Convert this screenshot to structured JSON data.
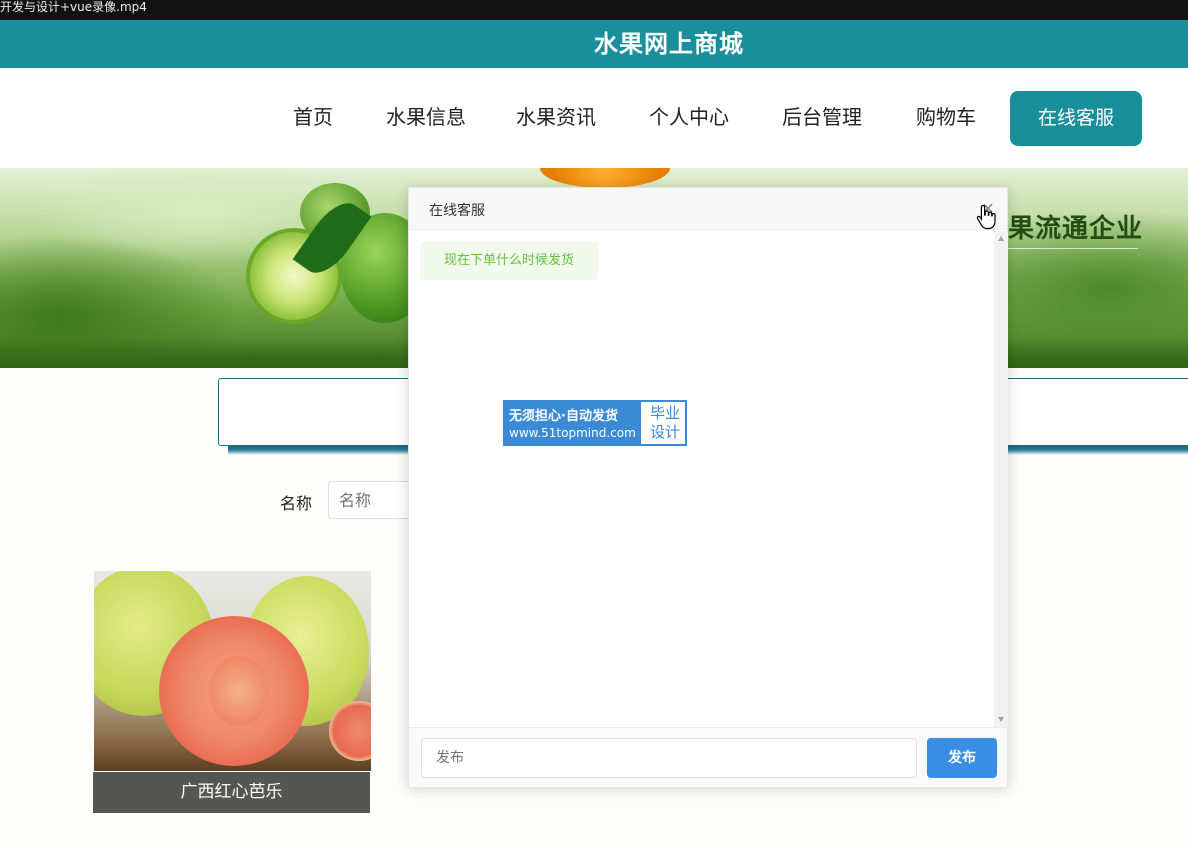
{
  "video_filename": "开发与设计+vue录像.mp4",
  "site": {
    "title": "水果网上商城"
  },
  "nav": {
    "items": [
      {
        "label": "首页"
      },
      {
        "label": "水果信息"
      },
      {
        "label": "水果资讯"
      },
      {
        "label": "个人中心"
      },
      {
        "label": "后台管理"
      },
      {
        "label": "购物车"
      }
    ],
    "customer_service_label": "在线客服"
  },
  "banner": {
    "text": "果流通企业"
  },
  "search": {
    "name_label": "名称",
    "name_placeholder": "名称"
  },
  "products": [
    {
      "name": "广西红心芭乐"
    }
  ],
  "chat": {
    "title": "在线客服",
    "close_icon": "close-icon",
    "messages": [
      {
        "text": "现在下单什么时候发货"
      }
    ],
    "input_placeholder": "发布",
    "send_label": "发布"
  },
  "watermark": {
    "line1": "无须担心·自动发货",
    "line2": "www.51topmind.com",
    "right_text": "毕业设计"
  },
  "colors": {
    "brand_teal": "#1a8f9c",
    "send_blue": "#3a8ee6",
    "message_green": "#67c23a"
  }
}
